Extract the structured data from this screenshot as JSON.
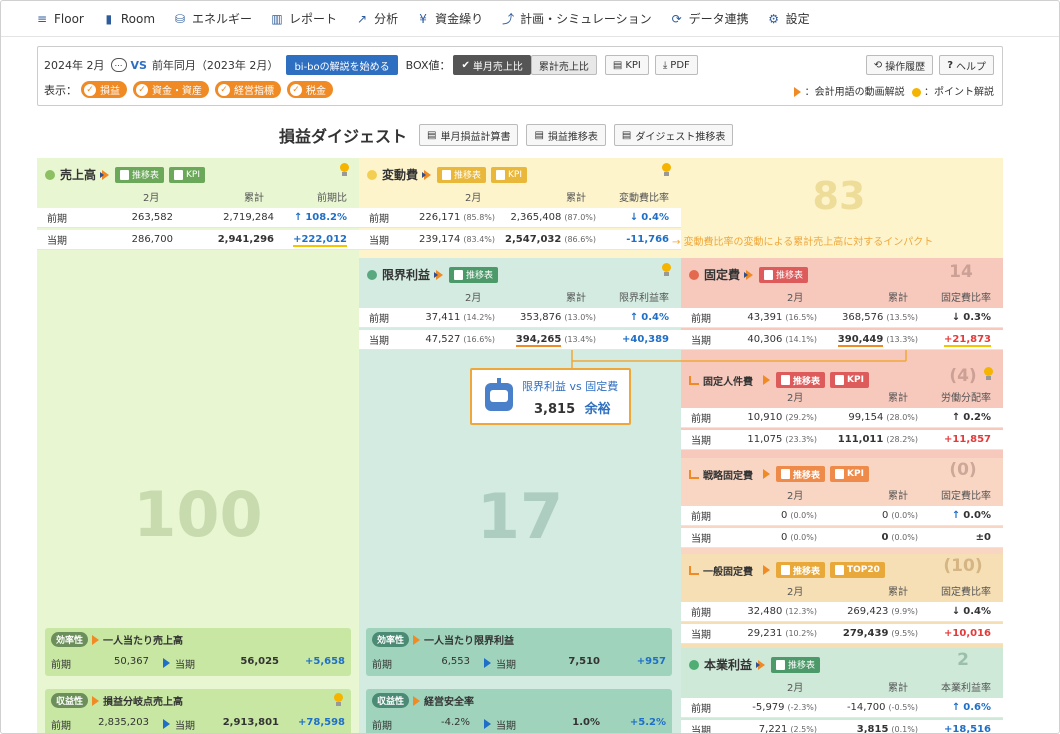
{
  "nav": {
    "items": [
      {
        "label": "Floor",
        "icon": "floor-icon",
        "glyph": "≡"
      },
      {
        "label": "Room",
        "icon": "room-icon",
        "glyph": "▮"
      },
      {
        "label": "エネルギー",
        "icon": "energy-icon",
        "glyph": "⛁"
      },
      {
        "label": "レポート",
        "icon": "report-icon",
        "glyph": "▥"
      },
      {
        "label": "分析",
        "icon": "analysis-icon",
        "glyph": "↗"
      },
      {
        "label": "資金繰り",
        "icon": "cashflow-icon",
        "glyph": "¥"
      },
      {
        "label": "計画・シミュレーション",
        "icon": "plan-icon",
        "glyph": "⤴"
      },
      {
        "label": "データ連携",
        "icon": "data-link-icon",
        "glyph": "⟳"
      },
      {
        "label": "設定",
        "icon": "settings-gear-icon",
        "glyph": "⚙"
      }
    ]
  },
  "controls": {
    "period": "2024年 2月",
    "vs": "VS",
    "compare": "前年同月（2023年 2月）",
    "explain_button": "bi-boの解説を始める",
    "box_label": "BOX値：",
    "box_single": "単月売上比",
    "box_cumulative": "累計売上比",
    "kpi_button": "KPI",
    "pdf_button": "PDF",
    "history_button": "操作履歴",
    "help_button": "ヘルプ",
    "display_label": "表示：",
    "chips": [
      "損益",
      "資金・資産",
      "経営指標",
      "税金"
    ],
    "legend_video": "：会計用語の動画解説",
    "legend_point": "：ポイント解説"
  },
  "digest": {
    "title": "損益ダイジェスト",
    "btn_monthly": "単月損益計算書",
    "btn_trend": "損益推移表",
    "btn_digest_trend": "ダイジェスト推移表"
  },
  "common": {
    "month": "2月",
    "cumulative": "累計",
    "prev": "前期",
    "curr": "当期",
    "trend": "推移表",
    "kpi": "KPI",
    "top20": "TOP20"
  },
  "sales": {
    "title": "売上高",
    "ratio_label": "前期比",
    "big": "100",
    "prev": {
      "m": "263,582",
      "c": "2,719,284",
      "r": "108.2%"
    },
    "curr": {
      "m": "286,700",
      "c": "2,941,296",
      "r": "+222,012"
    },
    "sub1": {
      "tag": "効率性",
      "title": "一人当たり売上高",
      "prev": "50,367",
      "curr": "56,025",
      "diff": "+5,658"
    },
    "sub2": {
      "tag": "収益性",
      "title": "損益分岐点売上高",
      "prev": "2,835,203",
      "curr": "2,913,801",
      "diff": "+78,598"
    }
  },
  "variable": {
    "title": "変動費",
    "ratio_label": "変動費比率",
    "big": "83",
    "prev": {
      "m": "226,171",
      "mp": "(85.8%)",
      "c": "2,365,408",
      "cp": "(87.0%)",
      "r": "0.4%"
    },
    "curr": {
      "m": "239,174",
      "mp": "(83.4%)",
      "c": "2,547,032",
      "cp": "(86.6%)",
      "r": "-11,766"
    },
    "note": "変動費比率の変動による累計売上高に対するインパクト"
  },
  "margin": {
    "title": "限界利益",
    "ratio_label": "限界利益率",
    "big": "17",
    "prev": {
      "m": "37,411",
      "mp": "(14.2%)",
      "c": "353,876",
      "cp": "(13.0%)",
      "r": "0.4%"
    },
    "curr": {
      "m": "47,527",
      "mp": "(16.6%)",
      "c": "394,265",
      "cp": "(13.4%)",
      "r": "+40,389"
    },
    "sub1": {
      "tag": "効率性",
      "title": "一人当たり限界利益",
      "prev": "6,553",
      "curr": "7,510",
      "diff": "+957"
    },
    "sub2": {
      "tag": "収益性",
      "title": "経営安全率",
      "prev": "-4.2%",
      "curr": "1.0%",
      "diff": "+5.2%"
    }
  },
  "callout": {
    "title": "限界利益 vs 固定費",
    "value": "3,815",
    "word": "余裕"
  },
  "fixed": {
    "title": "固定費",
    "ratio_label": "固定費比率",
    "big": "14",
    "prev": {
      "m": "43,391",
      "mp": "(16.5%)",
      "c": "368,576",
      "cp": "(13.5%)",
      "r": "0.3%"
    },
    "curr": {
      "m": "40,306",
      "mp": "(14.1%)",
      "c": "390,449",
      "cp": "(13.3%)",
      "r": "+21,873"
    }
  },
  "personnel": {
    "title": "固定人件費",
    "ratio_label": "労働分配率",
    "big": "(4)",
    "prev": {
      "m": "10,910",
      "mp": "(29.2%)",
      "c": "99,154",
      "cp": "(28.0%)",
      "r": "0.2%"
    },
    "curr": {
      "m": "11,075",
      "mp": "(23.3%)",
      "c": "111,011",
      "cp": "(28.2%)",
      "r": "+11,857"
    }
  },
  "strategic": {
    "title": "戦略固定費",
    "ratio_label": "固定費比率",
    "big": "(0)",
    "prev": {
      "m": "0",
      "mp": "(0.0%)",
      "c": "0",
      "cp": "(0.0%)",
      "r": "0.0%"
    },
    "curr": {
      "m": "0",
      "mp": "(0.0%)",
      "c": "0",
      "cp": "(0.0%)",
      "r": "±0"
    }
  },
  "general": {
    "title": "一般固定費",
    "ratio_label": "固定費比率",
    "big": "(10)",
    "prev": {
      "m": "32,480",
      "mp": "(12.3%)",
      "c": "269,423",
      "cp": "(9.9%)",
      "r": "0.4%"
    },
    "curr": {
      "m": "29,231",
      "mp": "(10.2%)",
      "c": "279,439",
      "cp": "(9.5%)",
      "r": "+10,016"
    }
  },
  "operating": {
    "title": "本業利益",
    "ratio_label": "本業利益率",
    "big": "2",
    "prev": {
      "m": "-5,979",
      "mp": "(-2.3%)",
      "c": "-14,700",
      "cp": "(-0.5%)",
      "r": "0.6%"
    },
    "curr": {
      "m": "7,221",
      "mp": "(2.5%)",
      "c": "3,815",
      "cp": "(0.1%)",
      "r": "+18,516"
    }
  },
  "colors": {
    "accent": "#f08a24",
    "blue": "#1f6fc7",
    "red": "#e43a3a",
    "sales": "#e8f6d2",
    "variable": "#fdf4cc",
    "margin": "#d3ebe1",
    "fixed": "#f7c9bd"
  }
}
